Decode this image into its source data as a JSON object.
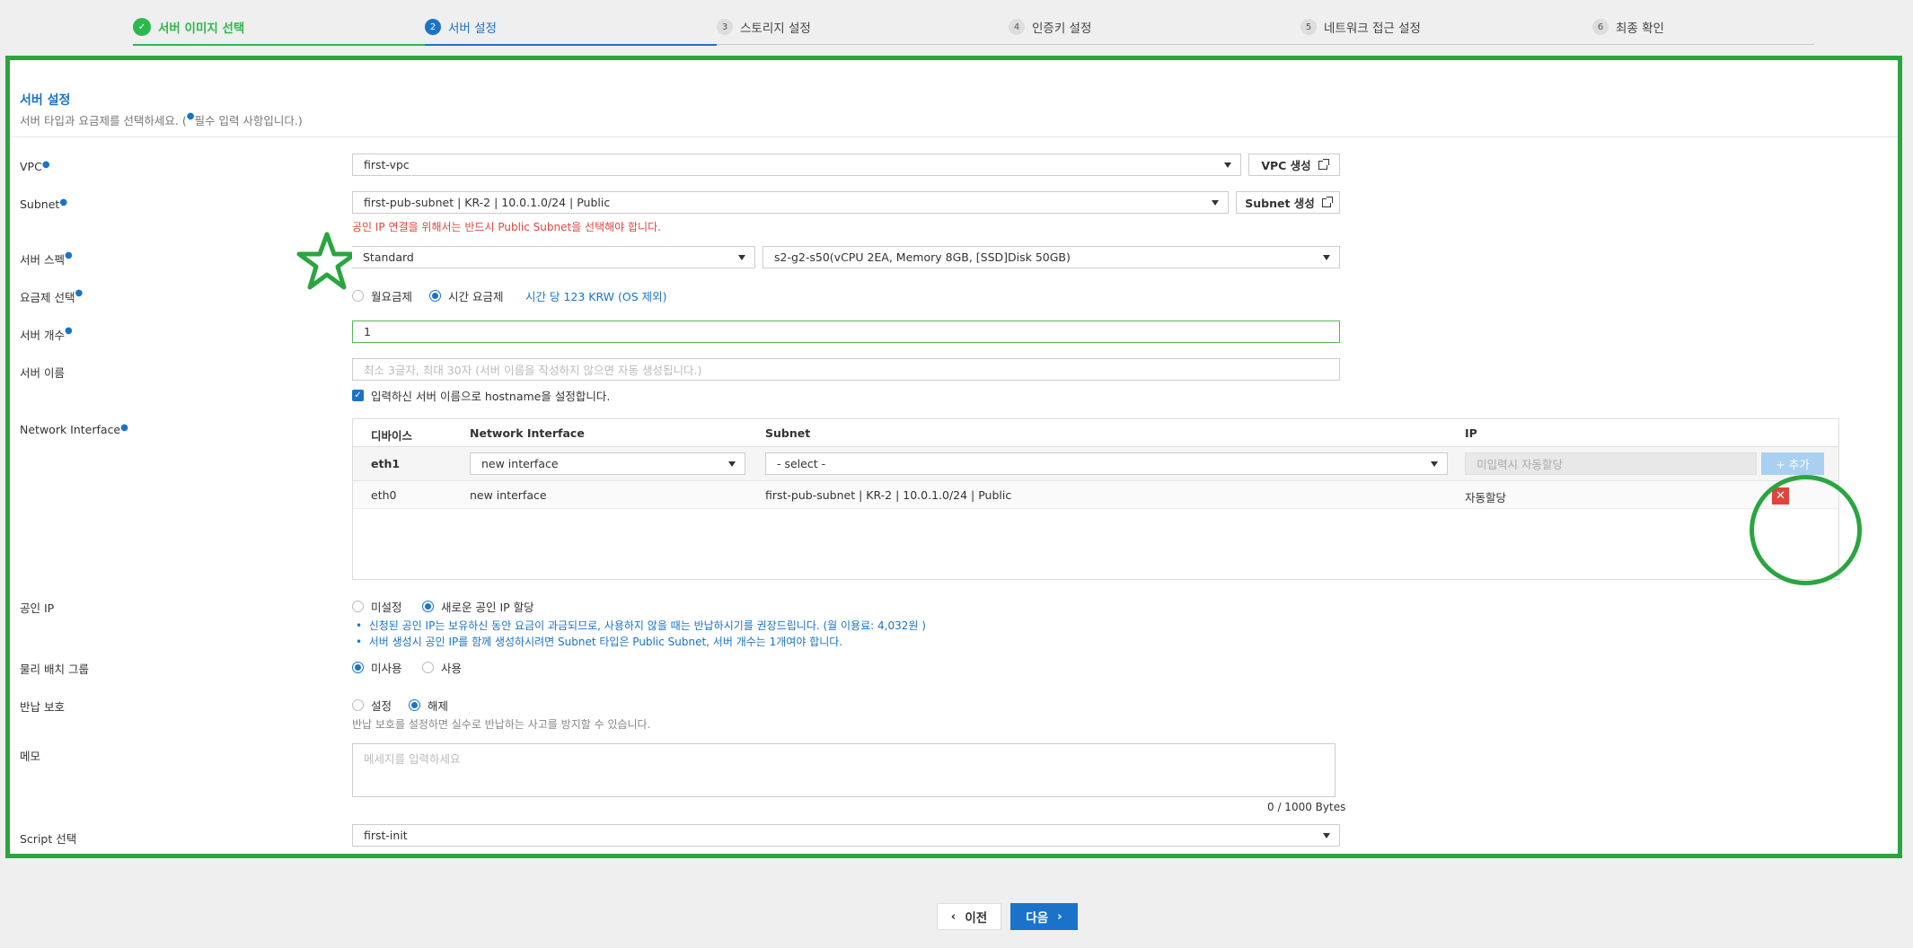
{
  "stepper": {
    "steps": [
      {
        "num": "✓",
        "label": "서버 이미지 선택",
        "state": "done"
      },
      {
        "num": "2",
        "label": "서버 설정",
        "state": "active"
      },
      {
        "num": "3",
        "label": "스토리지 설정",
        "state": "todo"
      },
      {
        "num": "4",
        "label": "인증키 설정",
        "state": "todo"
      },
      {
        "num": "5",
        "label": "네트워크 접근 설정",
        "state": "todo"
      },
      {
        "num": "6",
        "label": "최종 확인",
        "state": "todo"
      }
    ]
  },
  "section": {
    "title": "서버 설정",
    "desc_before": "서버 타입과 요금제를 선택하세요. (",
    "desc_after": "필수 입력 사항입니다.)"
  },
  "form": {
    "vpc": {
      "label": "VPC",
      "value": "first-vpc",
      "button": "VPC 생성"
    },
    "subnet": {
      "label": "Subnet",
      "value": "first-pub-subnet | KR-2 | 10.0.1.0/24 | Public",
      "button": "Subnet 생성",
      "warning": "공인 IP 연결을 위해서는 반드시 Public Subnet을 선택해야 합니다."
    },
    "spec": {
      "label": "서버 스펙",
      "type": "Standard",
      "value": "s2-g2-s50(vCPU 2EA, Memory 8GB, [SSD]Disk 50GB)"
    },
    "pricing": {
      "label": "요금제 선택",
      "monthly": "월요금제",
      "hourly": "시간 요금제",
      "price": "시간 당 123 KRW (OS 제외)"
    },
    "count": {
      "label": "서버 개수",
      "value": "1"
    },
    "name": {
      "label": "서버 이름",
      "placeholder": "최소 3글자, 최대 30자 (서버 이름을 작성하지 않으면 자동 생성됩니다.)",
      "hostname_check": "입력하신 서버 이름으로 hostname을 설정합니다."
    },
    "network": {
      "label": "Network Interface",
      "headers": [
        "디바이스",
        "Network Interface",
        "Subnet",
        "IP"
      ],
      "row1": {
        "device": "eth1",
        "interface": "new interface",
        "subnet": "- select -",
        "ip_placeholder": "미입력시 자동할당",
        "add_button": "+ 추가"
      },
      "row2": {
        "device": "eth0",
        "interface": "new interface",
        "subnet": "first-pub-subnet | KR-2 | 10.0.1.0/24 | Public",
        "ip": "자동할당"
      }
    },
    "public_ip": {
      "label": "공인 IP",
      "none": "미설정",
      "new": "새로운 공인 IP 할당",
      "note1": "신청된 공인 IP는 보유하신 동안 요금이 과금되므로, 사용하지 않을 때는 반납하시기를 권장드립니다. (월 이용료: 4,032원 )",
      "note2": "서버 생성시 공인 IP를 함께 생성하시려면 Subnet 타입은 Public Subnet, 서버 개수는 1개여야 합니다."
    },
    "placement": {
      "label": "물리 배치 그룹",
      "unused": "미사용",
      "used": "사용"
    },
    "protection": {
      "label": "반납 보호",
      "set": "설정",
      "unset": "해제",
      "desc": "반납 보호를 설정하면 실수로 반납하는 사고를 방지할 수 있습니다."
    },
    "memo": {
      "label": "메모",
      "placeholder": "메세지를 입력하세요",
      "counter": "0 / 1000 Bytes"
    },
    "script": {
      "label": "Script 선택",
      "value": "first-init"
    }
  },
  "footer": {
    "prev": "이전",
    "next": "다음"
  },
  "colors": {
    "accent": "#1a73c8",
    "highlight": "#2aa540",
    "danger": "#e0453d"
  }
}
